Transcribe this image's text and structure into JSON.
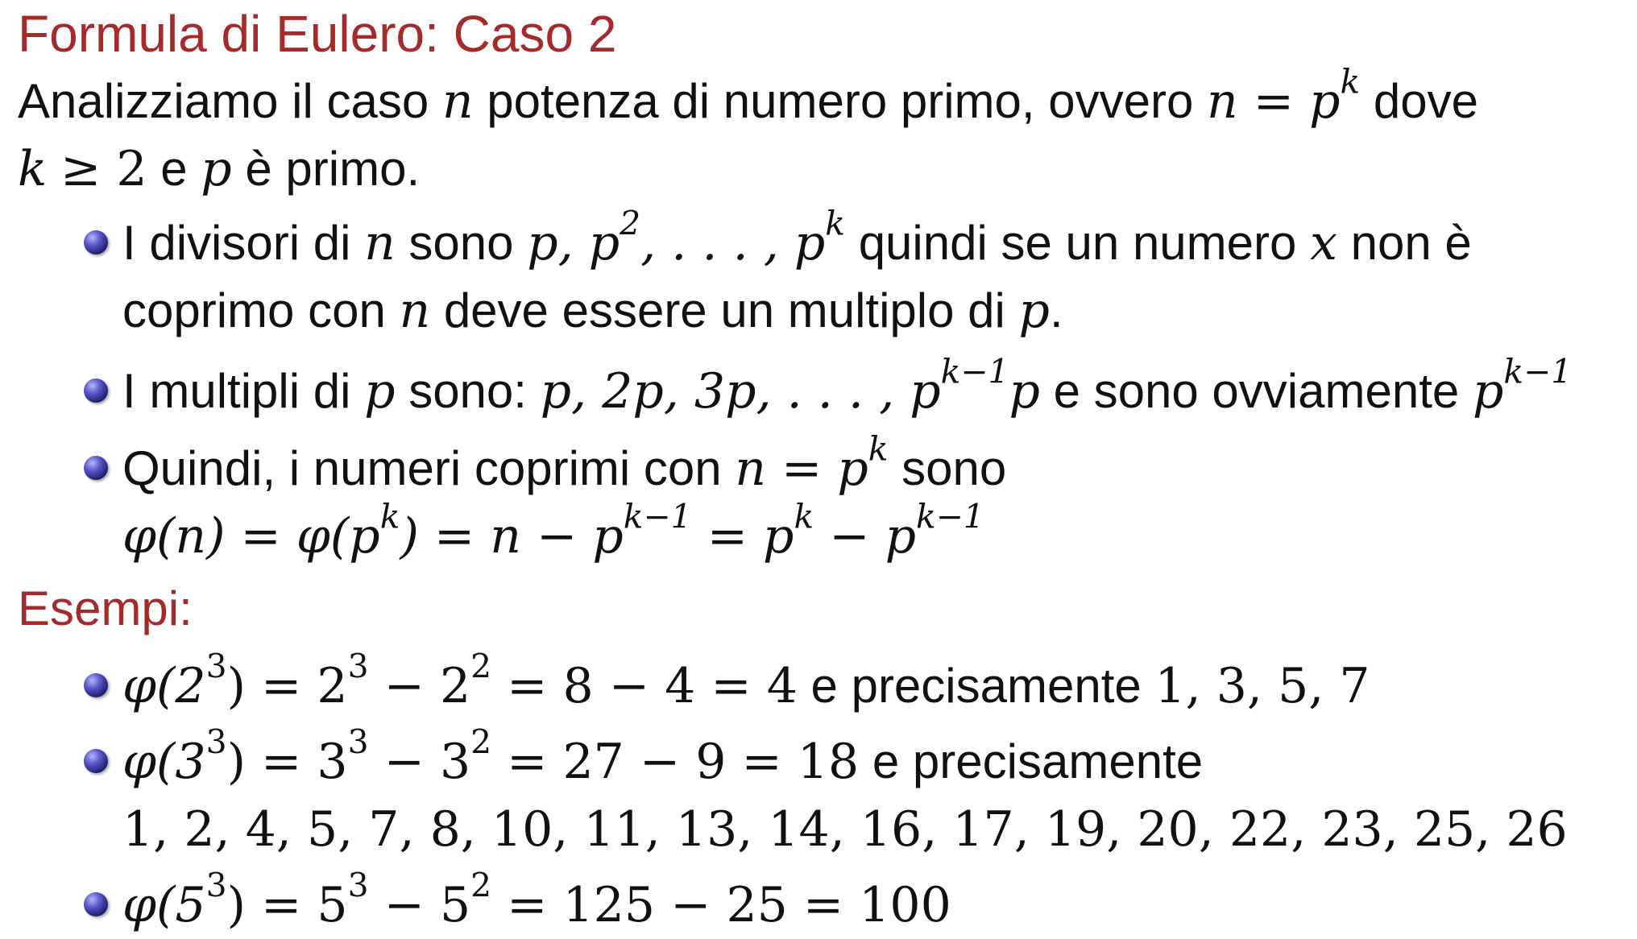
{
  "slide": {
    "title": "Formula di Eulero: Caso 2",
    "intro": {
      "line1_a": "Analizziamo il caso",
      "n": "n",
      "line1_b": "potenza di numero primo, ovvero",
      "eq": "n = p",
      "eq_sup": "k",
      "line1_c": "dove",
      "k": "k",
      "geq2": "≥ 2",
      "line2_a": "e",
      "p": "p",
      "line2_b": "è primo."
    },
    "bullets": [
      {
        "a": "I divisori di",
        "n": "n",
        "b": "sono",
        "list1": "p, p",
        "sup2": "2",
        "list2": ", . . . , p",
        "supk": "k",
        "c": "quindi se un numero",
        "x": "x",
        "d": "non è coprimo con",
        "n2": "n",
        "e": "deve essere un multiplo di",
        "p": "p",
        "f": "."
      },
      {
        "a": "I multipli di",
        "p": "p",
        "b": "sono:",
        "list": "p, 2p, 3p, . . . , p",
        "supk1": "k−1",
        "list_end": "p",
        "c": "e sono ovviamente",
        "pk1": "p",
        "pk1_sup": "k−1"
      },
      {
        "a": "Quindi, i numeri coprimi con",
        "eq": "n = p",
        "eq_sup": "k",
        "b": "sono",
        "f1": "φ(n) = φ(p",
        "f1_sup": "k",
        "f2": ") = n − p",
        "f2_sup": "k−1",
        "f3": " = p",
        "f3_sup": "k",
        "f4": " − p",
        "f4_sup": "k−1"
      }
    ],
    "examples_title": "Esempi:",
    "examples": [
      {
        "phi": "φ(2",
        "s1": "3",
        "a": ") = 2",
        "s2": "3",
        "b": " − 2",
        "s3": "2",
        "c": " = 8 − 4 = 4",
        "text": "e precisamente",
        "list": "1, 3, 5, 7"
      },
      {
        "phi": "φ(3",
        "s1": "3",
        "a": ") = 3",
        "s2": "3",
        "b": " − 3",
        "s3": "2",
        "c": " = 27 − 9 = 18",
        "text": "e precisamente",
        "list": "1, 2, 4, 5, 7, 8, 10, 11, 13, 14, 16, 17, 19, 20, 22, 23, 25, 26"
      },
      {
        "phi": "φ(5",
        "s1": "3",
        "a": ") = 5",
        "s2": "3",
        "b": " − 5",
        "s3": "2",
        "c": " = 125 − 25 = 100"
      }
    ]
  }
}
